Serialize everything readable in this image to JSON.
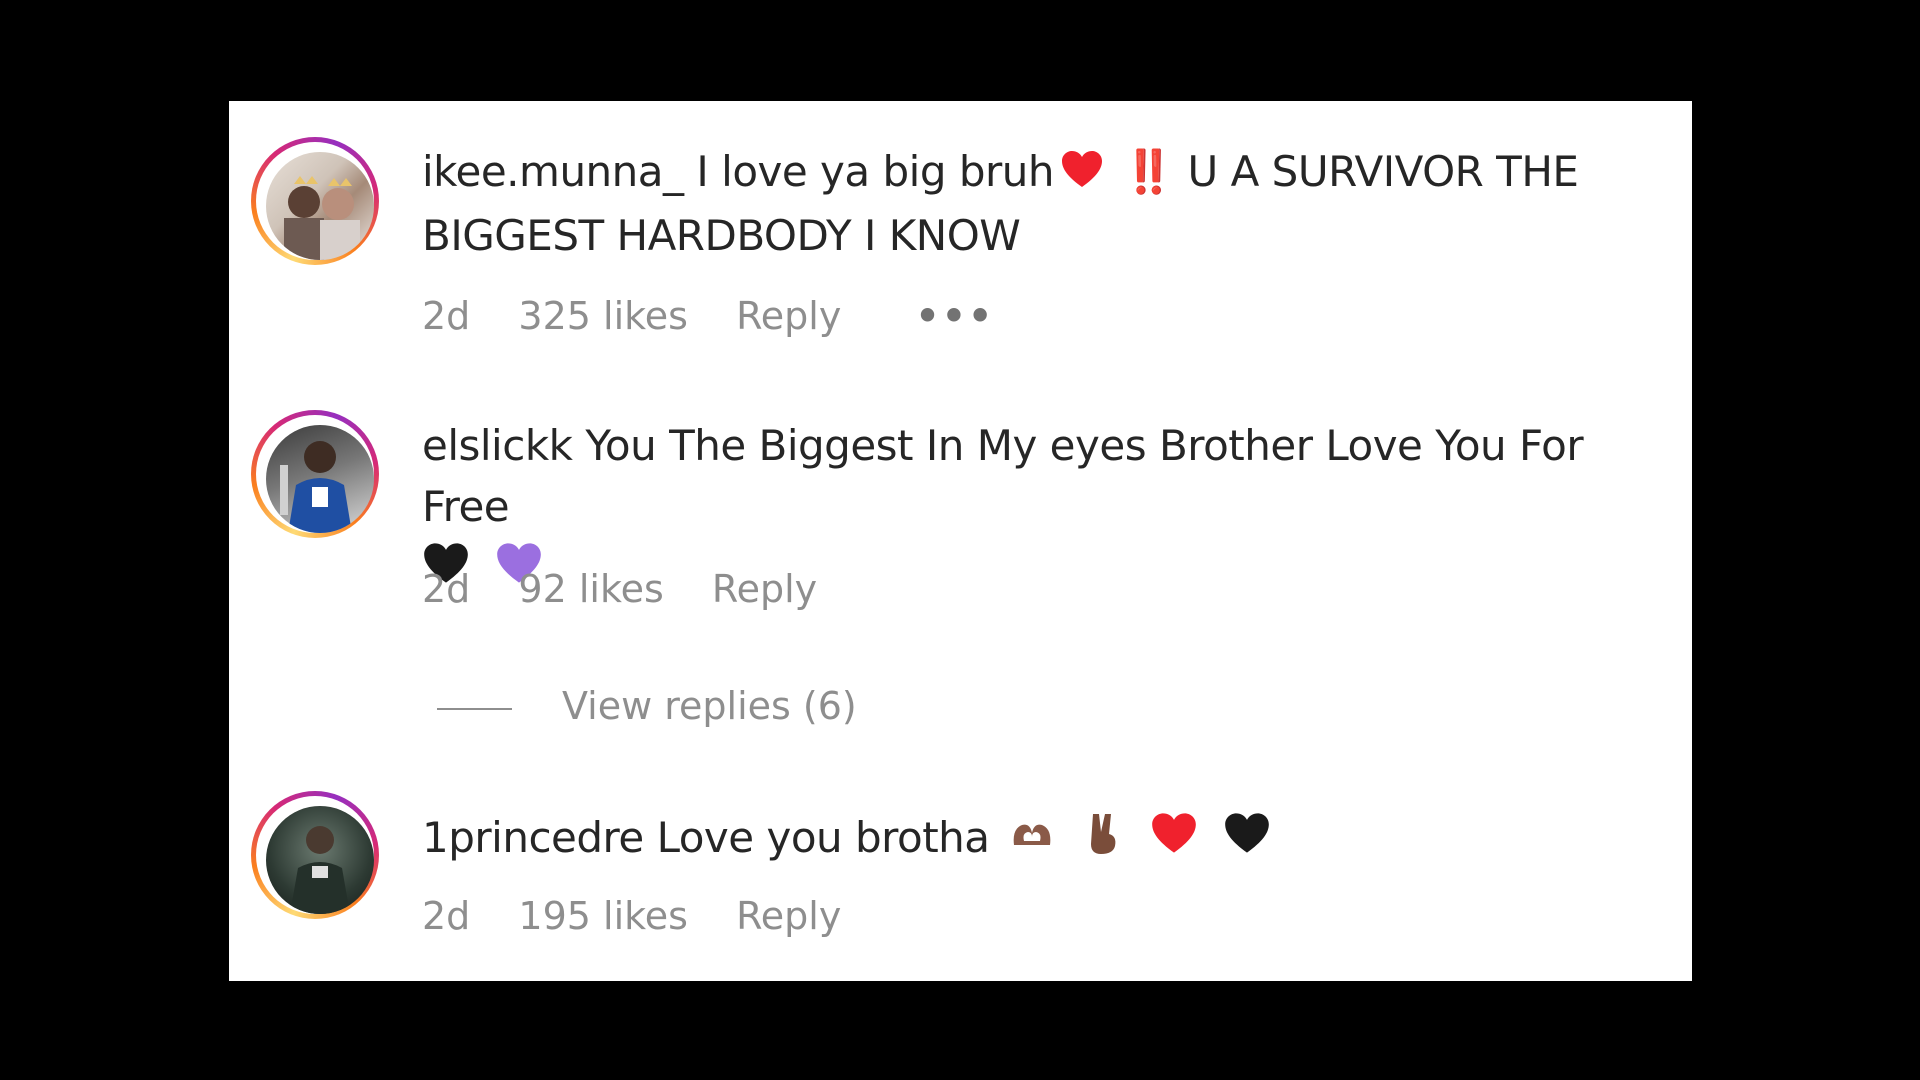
{
  "comments": [
    {
      "username": "ikee.munna_",
      "text_before": "I love ya big bruh",
      "text_emoji": "red-heart-icon",
      "text_after": " ‼️ U A SURVIVOR THE BIGGEST HARDBODY I KNOW",
      "time": "2d",
      "likes": "325 likes",
      "reply": "Reply",
      "more": "•••"
    },
    {
      "username": "elslickk",
      "text_before": "You The Biggest In My eyes Brother Love You For Free",
      "emojis": [
        "black-heart-icon",
        "purple-heart-icon"
      ],
      "time": "2d",
      "likes": "92 likes",
      "reply": "Reply",
      "view_replies": "View replies (6)"
    },
    {
      "username": "1princedre",
      "text_before": "Love you brotha",
      "emojis": [
        "heart-hands-icon",
        "victory-hand-icon",
        "red-heart-icon",
        "black-heart-icon"
      ],
      "time": "2d",
      "likes": "195 likes",
      "reply": "Reply"
    }
  ],
  "colors": {
    "background": "#000000",
    "panel": "#ffffff",
    "text": "#262626",
    "secondary": "#8e8e8e"
  }
}
